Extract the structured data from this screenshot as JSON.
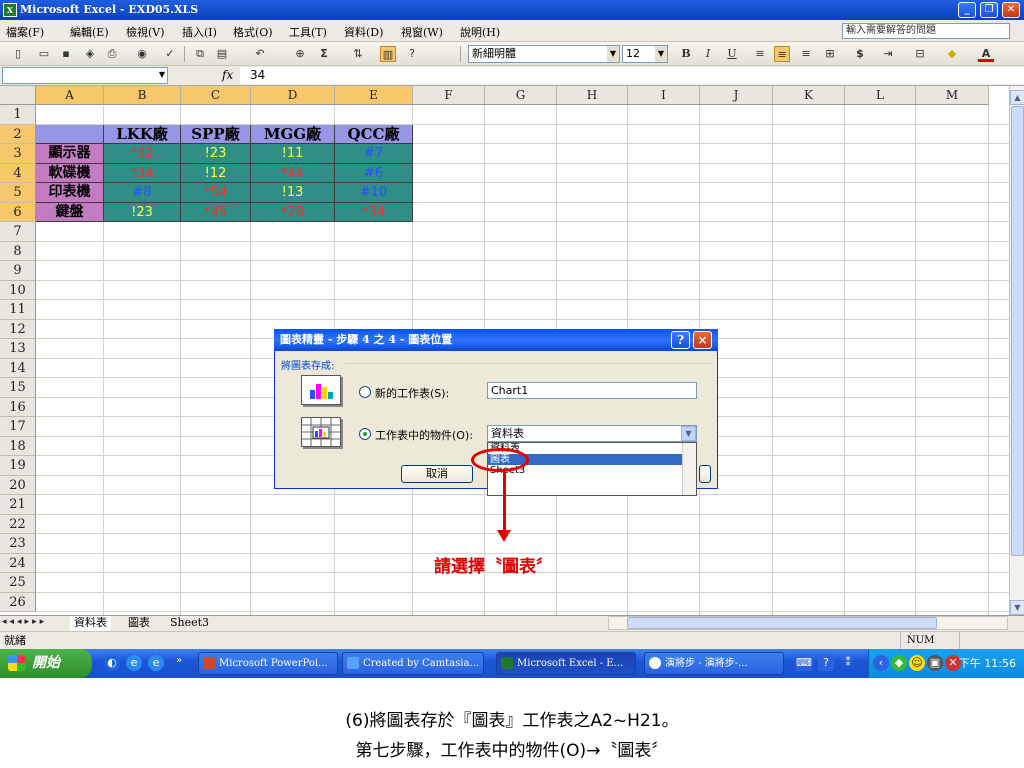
{
  "window": {
    "title": "Microsoft Excel - EXD05.XLS",
    "app_icon": "excel-icon"
  },
  "menu": {
    "items": [
      "檔案(F)",
      "編輯(E)",
      "檢視(V)",
      "插入(I)",
      "格式(O)",
      "工具(T)",
      "資料(D)",
      "視窗(W)",
      "說明(H)"
    ],
    "help_placeholder": "輸入需要解答的問題"
  },
  "toolbar": {
    "font_name": "新細明體",
    "font_size": "12",
    "bold": "B",
    "italic": "I",
    "underline": "U",
    "currency": "$",
    "autosum": "Σ",
    "font_color_letter": "A"
  },
  "formula_bar": {
    "name_box": "",
    "fx": "fx",
    "value": "34"
  },
  "columns": [
    "A",
    "B",
    "C",
    "D",
    "E",
    "F",
    "G",
    "H",
    "I",
    "J",
    "K",
    "L",
    "M"
  ],
  "rows": [
    "1",
    "2",
    "3",
    "4",
    "5",
    "6",
    "7",
    "8",
    "9",
    "10",
    "11",
    "12",
    "13",
    "14",
    "15",
    "16",
    "17",
    "18",
    "19",
    "20",
    "21",
    "22",
    "23",
    "24",
    "25",
    "26"
  ],
  "table": {
    "headers": [
      "LKK廠",
      "SPP廠",
      "MGG廠",
      "QCC廠"
    ],
    "row_labels": [
      "顯示器",
      "軟碟機",
      "印表機",
      "鍵盤"
    ],
    "cells": [
      [
        {
          "text": "*32",
          "color": "#ff2a2a"
        },
        {
          "text": "!23",
          "color": "#ffff40"
        },
        {
          "text": "!11",
          "color": "#ffff40"
        },
        {
          "text": "#7",
          "color": "#2a4fff"
        }
      ],
      [
        {
          "text": "*34",
          "color": "#ff2a2a"
        },
        {
          "text": "!12",
          "color": "#ffff40"
        },
        {
          "text": "*44",
          "color": "#ff2a2a"
        },
        {
          "text": "#6",
          "color": "#2a4fff"
        }
      ],
      [
        {
          "text": "#8",
          "color": "#2a4fff"
        },
        {
          "text": "*54",
          "color": "#ff2a2a"
        },
        {
          "text": "!13",
          "color": "#ffff40"
        },
        {
          "text": "#10",
          "color": "#2a4fff"
        }
      ],
      [
        {
          "text": "!23",
          "color": "#ffff40"
        },
        {
          "text": "*45",
          "color": "#ff2a2a"
        },
        {
          "text": "*28",
          "color": "#ff2a2a"
        },
        {
          "text": "*34",
          "color": "#ff2a2a"
        }
      ]
    ]
  },
  "sheet_tabs": [
    "資料表",
    "圖表",
    "Sheet3"
  ],
  "status": {
    "left": "就緒",
    "num": "NUM"
  },
  "taskbar": {
    "start": "開始",
    "tasks": [
      "Microsoft PowerPoi...",
      "Created by Camtasia...",
      "Microsoft Excel - E...",
      "演將步 - 演將步-..."
    ],
    "clock": "下午 11:56"
  },
  "dialog": {
    "title": "圖表精靈 - 步驟 4 之 4 - 圖表位置",
    "group_label": "將圖表存成:",
    "option_new_sheet": "新的工作表(S):",
    "option_object": "工作表中的物件(O):",
    "new_sheet_value": "Chart1",
    "object_value": "資料表",
    "list_items": [
      "資料表",
      "圖表",
      "Sheet3"
    ],
    "cancel_label": "取消",
    "help_label": "?",
    "close_label": "×"
  },
  "annotation": {
    "text": "請選擇〝圖表〞",
    "color": "#e40000"
  },
  "caption": {
    "line1": "(6)將圖表存於『圖表』工作表之A2~H21。",
    "line2": "第七步驟，工作表中的物件(O)→〝圖表〞"
  }
}
